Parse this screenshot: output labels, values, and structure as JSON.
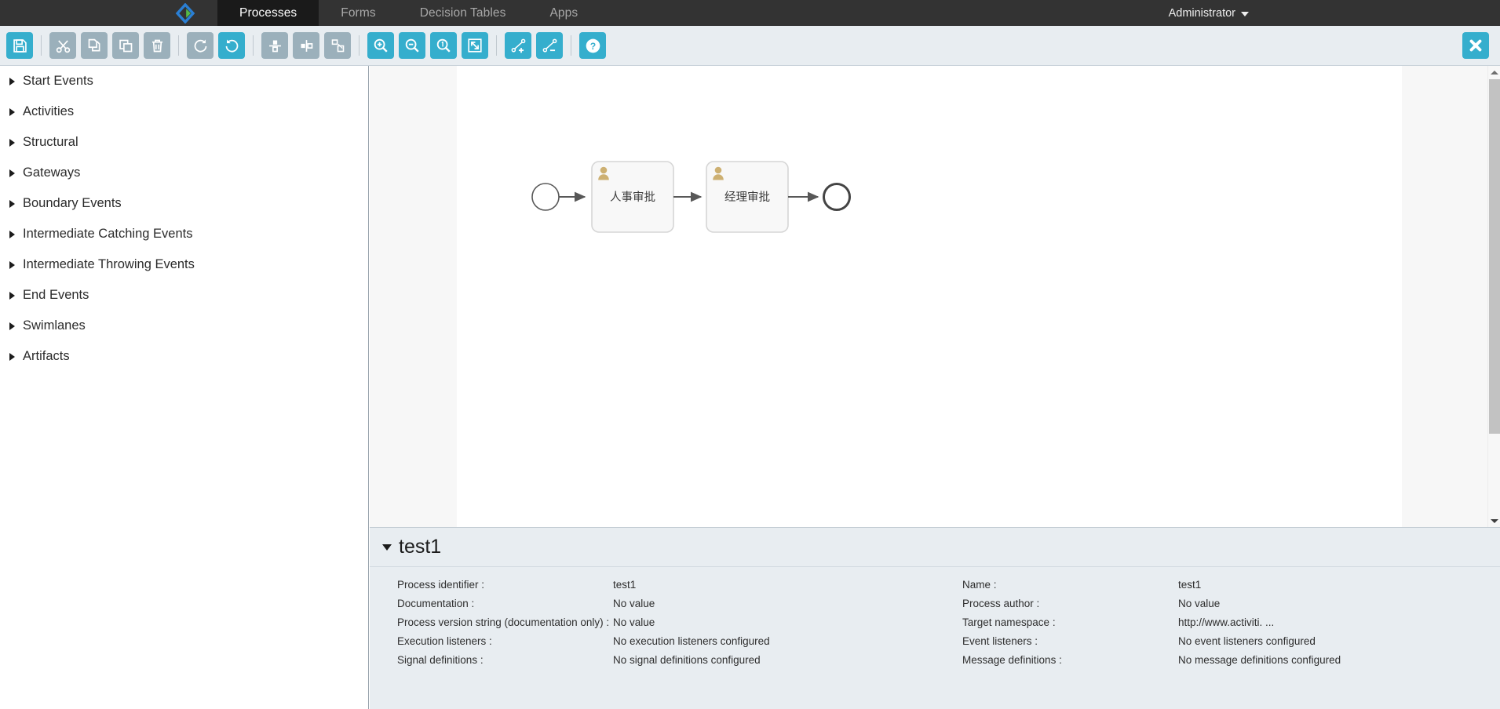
{
  "topnav": {
    "logo_icon": "activiti-diamond-logo",
    "tabs": [
      {
        "label": "Processes",
        "active": true
      },
      {
        "label": "Forms",
        "active": false
      },
      {
        "label": "Decision Tables",
        "active": false
      },
      {
        "label": "Apps",
        "active": false
      }
    ],
    "user": "Administrator"
  },
  "toolbar": {
    "buttons": [
      {
        "name": "save-button",
        "icon": "floppy-disk-icon",
        "state": "on"
      },
      {
        "name": "cut-button",
        "icon": "scissors-icon",
        "state": "off"
      },
      {
        "name": "copy-button",
        "icon": "copy-icon",
        "state": "off"
      },
      {
        "name": "paste-button",
        "icon": "paste-icon",
        "state": "off"
      },
      {
        "name": "delete-button",
        "icon": "trash-icon",
        "state": "off"
      },
      {
        "name": "redo-button",
        "icon": "redo-arrow-icon",
        "state": "off"
      },
      {
        "name": "undo-button",
        "icon": "undo-arrow-icon",
        "state": "on"
      },
      {
        "name": "align-vertical-button",
        "icon": "align-vertical-icon",
        "state": "off"
      },
      {
        "name": "align-horizontal-button",
        "icon": "align-horizontal-icon",
        "state": "off"
      },
      {
        "name": "same-size-button",
        "icon": "same-size-icon",
        "state": "off"
      },
      {
        "name": "zoom-in-button",
        "icon": "magnifier-plus-icon",
        "state": "on"
      },
      {
        "name": "zoom-out-button",
        "icon": "magnifier-minus-icon",
        "state": "on"
      },
      {
        "name": "zoom-actual-button",
        "icon": "magnifier-one-icon",
        "state": "on"
      },
      {
        "name": "zoom-fit-button",
        "icon": "fit-to-screen-icon",
        "state": "on"
      },
      {
        "name": "add-bendpoint-button",
        "icon": "bendpoint-plus-icon",
        "state": "on"
      },
      {
        "name": "remove-bendpoint-button",
        "icon": "bendpoint-minus-icon",
        "state": "on"
      },
      {
        "name": "help-button",
        "icon": "question-mark-icon",
        "state": "on"
      }
    ],
    "close_button": {
      "name": "close-editor-button",
      "icon": "close-x-icon"
    }
  },
  "palette": {
    "items": [
      {
        "label": "Start Events"
      },
      {
        "label": "Activities"
      },
      {
        "label": "Structural"
      },
      {
        "label": "Gateways"
      },
      {
        "label": "Boundary Events"
      },
      {
        "label": "Intermediate Catching Events"
      },
      {
        "label": "Intermediate Throwing Events"
      },
      {
        "label": "End Events"
      },
      {
        "label": "Swimlanes"
      },
      {
        "label": "Artifacts"
      }
    ]
  },
  "diagram": {
    "start_event": {
      "name": "start-event-node"
    },
    "tasks": [
      {
        "label": "人事审批",
        "icon": "user-task-person-icon"
      },
      {
        "label": "经理审批",
        "icon": "user-task-person-icon"
      }
    ],
    "end_event": {
      "name": "end-event-node"
    }
  },
  "properties": {
    "title": "test1",
    "left_column": [
      {
        "label": "Process identifier :",
        "value": "test1"
      },
      {
        "label": "Documentation :",
        "value": "No value"
      },
      {
        "label": "Process version string (documentation only) :",
        "value": "No value"
      },
      {
        "label": "Execution listeners :",
        "value": "No execution listeners configured"
      },
      {
        "label": "Signal definitions :",
        "value": "No signal definitions configured"
      }
    ],
    "right_column": [
      {
        "label": "Name :",
        "value": "test1"
      },
      {
        "label": "Process author :",
        "value": "No value"
      },
      {
        "label": "Target namespace :",
        "value": "http://www.activiti. ..."
      },
      {
        "label": "Event listeners :",
        "value": "No event listeners configured"
      },
      {
        "label": "Message definitions :",
        "value": "No message definitions configured"
      }
    ]
  },
  "colors": {
    "accent": "#35aecd",
    "toolbar_inactive": "#9bb0bb",
    "nav_bg": "#333333",
    "toolbar_bg": "#e8edf1"
  }
}
